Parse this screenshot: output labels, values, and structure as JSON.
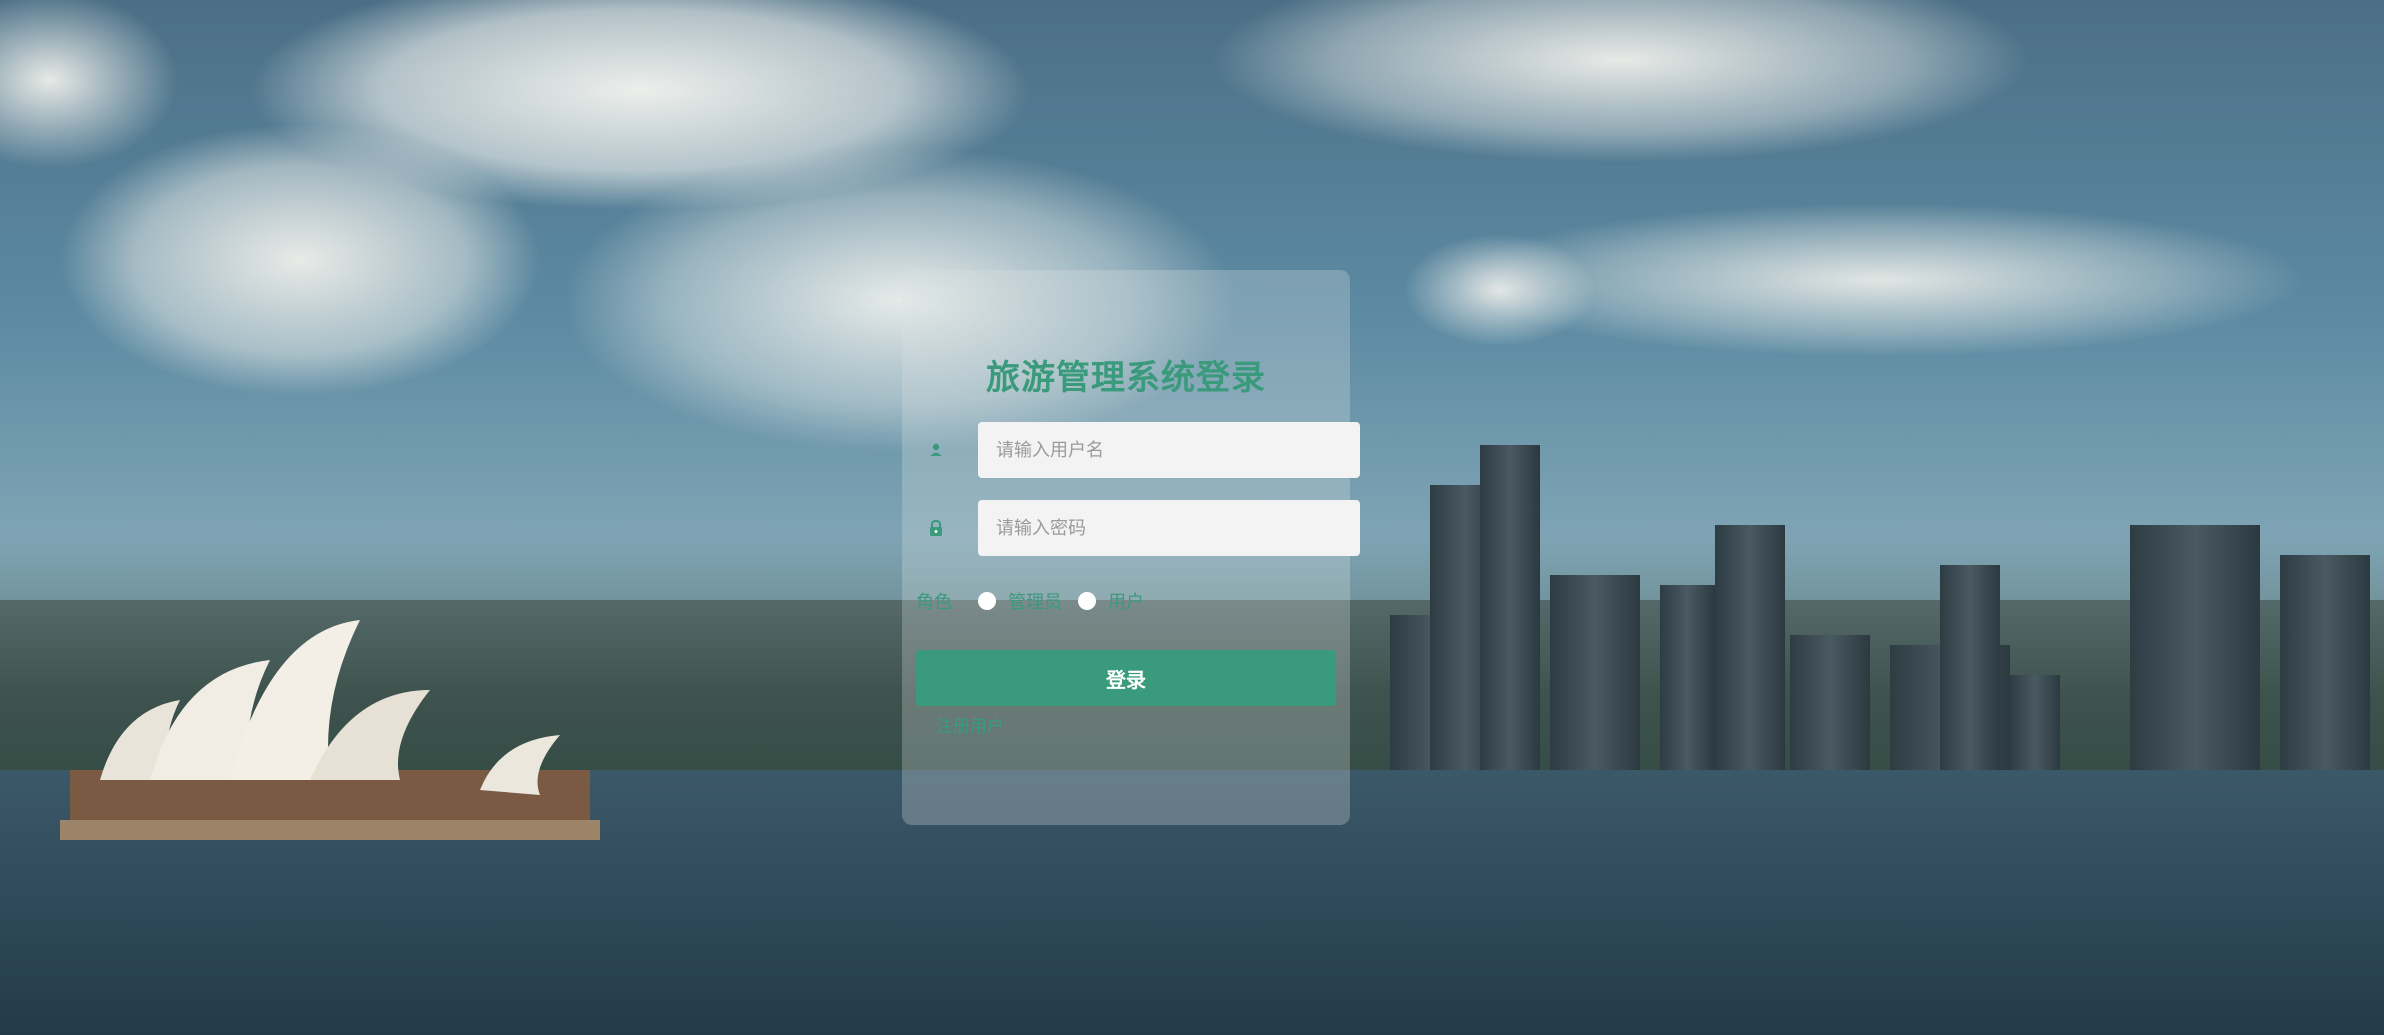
{
  "login": {
    "title": "旅游管理系统登录",
    "username_placeholder": "请输入用户名",
    "password_placeholder": "请输入密码",
    "role_label": "角色",
    "roles": [
      {
        "label": "管理员",
        "selected": false
      },
      {
        "label": "用户",
        "selected": false
      }
    ],
    "submit_label": "登录",
    "register_link": "注册用户"
  },
  "icons": {
    "username": "user-icon",
    "password": "lock-icon"
  },
  "colors": {
    "accent": "#3a9a7c",
    "input_bg": "#f3f3f3",
    "card_bg": "rgba(220,225,228,0.28)"
  }
}
